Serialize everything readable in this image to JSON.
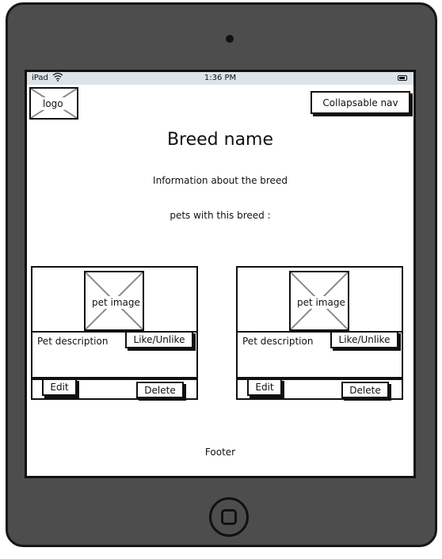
{
  "status_bar": {
    "carrier": "iPad",
    "wifi_icon": "wifi-icon",
    "time": "1:36 PM",
    "battery_icon": "battery-icon"
  },
  "header": {
    "logo_label": "logo",
    "nav_label": "Collapsable nav"
  },
  "main": {
    "title": "Breed name",
    "info": "Information about the breed",
    "pets_label": "pets with this breed :"
  },
  "cards": [
    {
      "image_label": "pet image",
      "description": "Pet description",
      "like_label": "Like/Unlike",
      "edit_label": "Edit",
      "delete_label": "Delete"
    },
    {
      "image_label": "pet image",
      "description": "Pet description",
      "like_label": "Like/Unlike",
      "edit_label": "Edit",
      "delete_label": "Delete"
    }
  ],
  "footer": {
    "text": "Footer"
  },
  "colors": {
    "frame": "#4d4d4d",
    "outline": "#111111",
    "status_bar": "#dde3e7",
    "placeholder_x": "#8a8a8a"
  }
}
